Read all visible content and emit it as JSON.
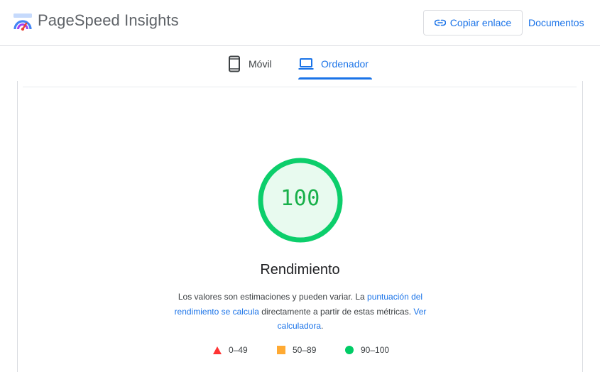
{
  "header": {
    "brand": "PageSpeed Insights",
    "copy_link_label": "Copiar enlace",
    "docs_label": "Documentos",
    "logo_icon": "pagespeed-logo-icon",
    "link_icon": "link-icon"
  },
  "tabs": [
    {
      "label": "Móvil",
      "icon": "smartphone-icon",
      "selected": false
    },
    {
      "label": "Ordenador",
      "icon": "laptop-icon",
      "selected": true
    }
  ],
  "score": {
    "value": "100",
    "title": "Rendimiento",
    "status_color": "#0cce6b"
  },
  "description": {
    "text_1": "Los valores son estimaciones y pueden variar. La ",
    "link_1": "puntuación del rendimiento se calcula",
    "text_2": " directamente a partir de estas métricas. ",
    "link_2": "Ver calculadora",
    "text_3": "."
  },
  "legend": [
    {
      "label": "0–49",
      "shape": "triangle",
      "color": "#ff3333"
    },
    {
      "label": "50–89",
      "shape": "square",
      "color": "#ffaa33"
    },
    {
      "label": "90–100",
      "shape": "circle",
      "color": "#00cc66"
    }
  ],
  "colors": {
    "accent": "#1a73e8",
    "pass": "#0cce6b",
    "average": "#ffa400",
    "fail": "#ff4e42"
  }
}
